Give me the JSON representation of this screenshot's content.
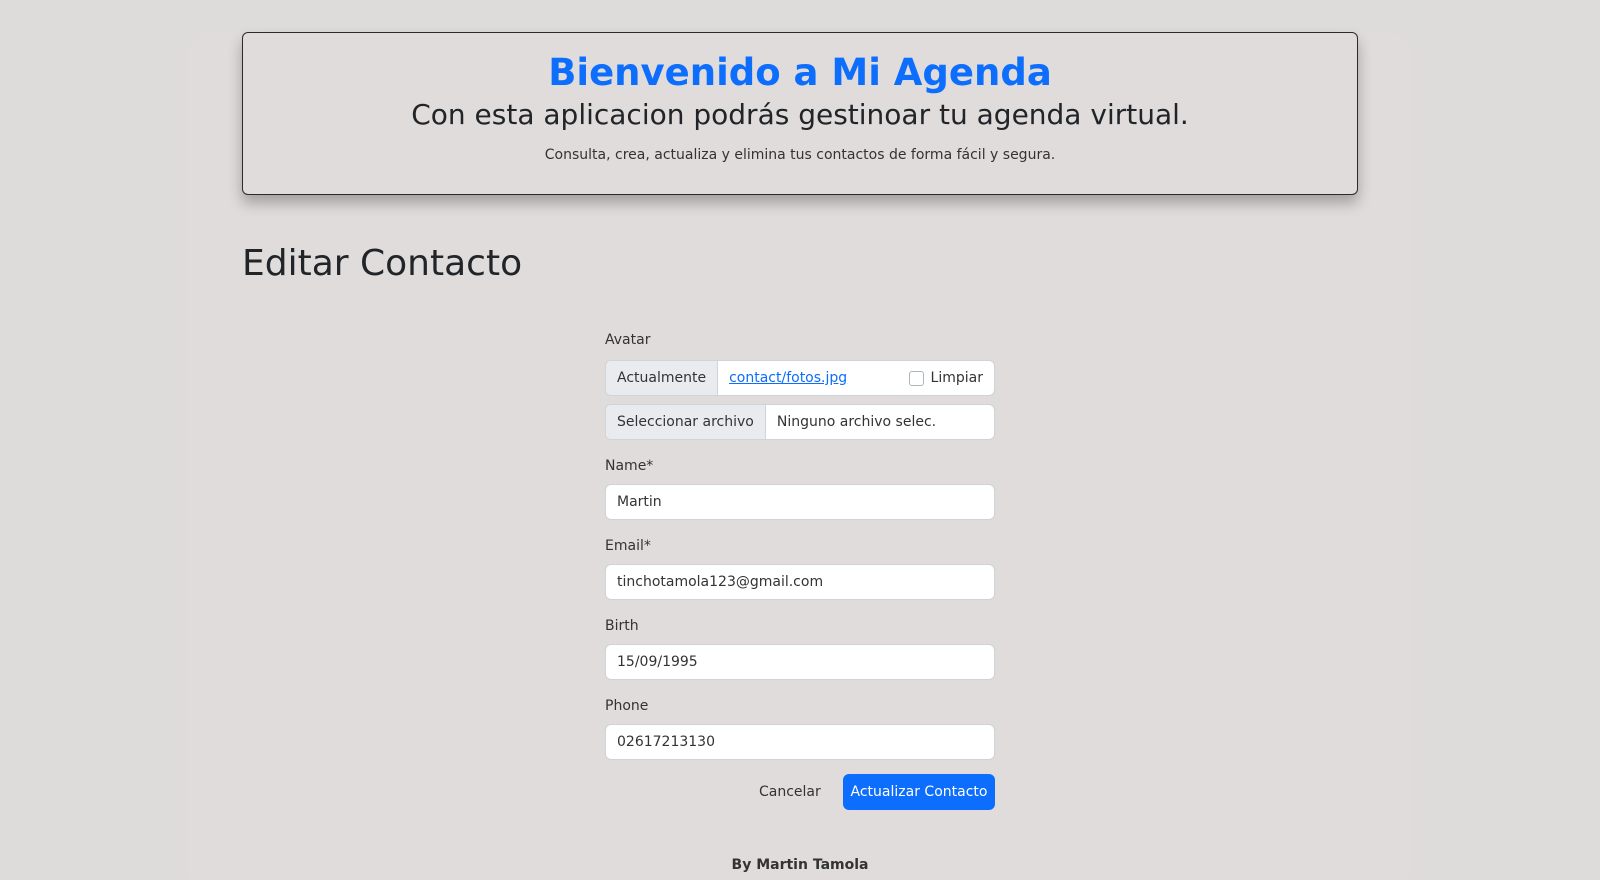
{
  "hero": {
    "title": "Bienvenido a Mi Agenda",
    "subtitle": "Con esta aplicacion podrás gestinoar tu agenda virtual.",
    "lead": "Consulta, crea, actualiza y elimina tus contactos de forma fácil y segura."
  },
  "page": {
    "title": "Editar Contacto"
  },
  "form": {
    "avatar": {
      "label": "Avatar",
      "current_label": "Actualmente",
      "current_value": "contact/fotos.jpg",
      "clear_label": "Limpiar",
      "clear_checked": false,
      "file_button": "Seleccionar archivo",
      "file_name": "Ninguno archivo selec."
    },
    "name": {
      "label": "Name*",
      "value": "Martin"
    },
    "email": {
      "label": "Email*",
      "value": "tinchotamola123@gmail.com"
    },
    "birth": {
      "label": "Birth",
      "value": "15/09/1995"
    },
    "phone": {
      "label": "Phone",
      "value": "02617213130"
    },
    "cancel_label": "Cancelar",
    "submit_label": "Actualizar Contacto"
  },
  "footer": {
    "text": "By Martin Tamola"
  },
  "colors": {
    "primary": "#0d6efd",
    "background": "#dedcdb",
    "text": "#212529"
  }
}
